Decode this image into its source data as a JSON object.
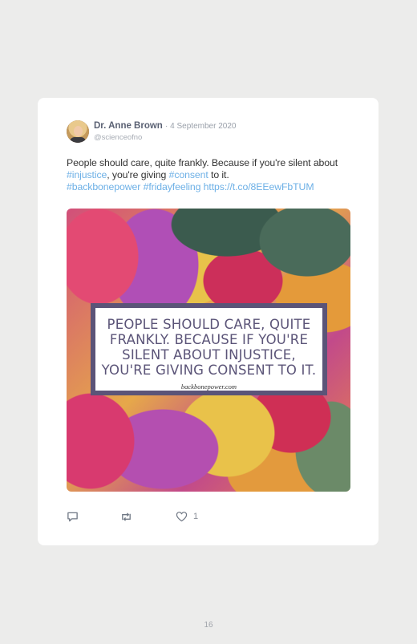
{
  "tweet": {
    "author_name": "Dr. Anne Brown",
    "date": "· 4 September 2020",
    "handle": "@scienceofno",
    "text_part1": "People should care, quite frankly. Because if you're silent about ",
    "tag_injustice": "#injustice",
    "text_part2": ", you're giving ",
    "tag_consent": "#consent",
    "text_part3": " to it.",
    "tag_backbonepower": "#backbonepower",
    "tag_fridayfeeling": "#fridayfeeling",
    "url": "https://t.co/8EEewFbTUM",
    "like_count": "1"
  },
  "image": {
    "quote_line1": "PEOPLE SHOULD CARE, QUITE",
    "quote_line2": "FRANKLY. BECAUSE IF YOU'RE",
    "quote_line3": "SILENT ABOUT INJUSTICE,",
    "quote_line4": "YOU'RE GIVING CONSENT TO IT.",
    "source": "backbonepower.com"
  },
  "icons": {
    "reply": "reply-icon",
    "retweet": "retweet-icon",
    "like": "heart-icon"
  },
  "colors": {
    "link": "#6db0e6",
    "quote_frame": "#5b5478",
    "background": "#ececeb"
  },
  "page": {
    "number": "16"
  }
}
